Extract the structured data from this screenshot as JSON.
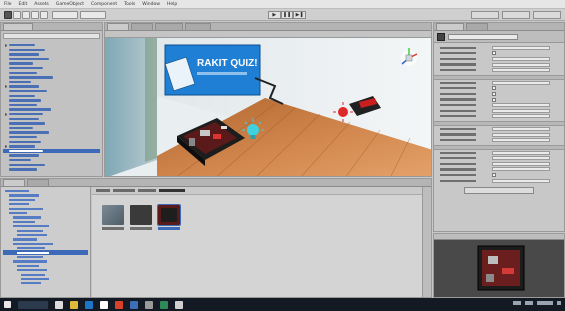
{
  "menu": {
    "items": [
      "File",
      "Edit",
      "Assets",
      "GameObject",
      "Component",
      "Tools",
      "Window",
      "Help"
    ]
  },
  "toolbar": {
    "play": "▶",
    "pause": "❚❚",
    "step": "▶❚"
  },
  "scene": {
    "poster_text": "RAKIT QUIZ!"
  },
  "colors": {
    "poster_bg": "#1e7fd4",
    "floor": "#c0733a",
    "selection": "#3d6ab8",
    "taskbar": "#131a24"
  },
  "icons": {
    "bulb": "lightbulb-icon",
    "scene_gizmo": "scene-gizmo-icon",
    "unity_logo": "unity-logo-icon"
  }
}
